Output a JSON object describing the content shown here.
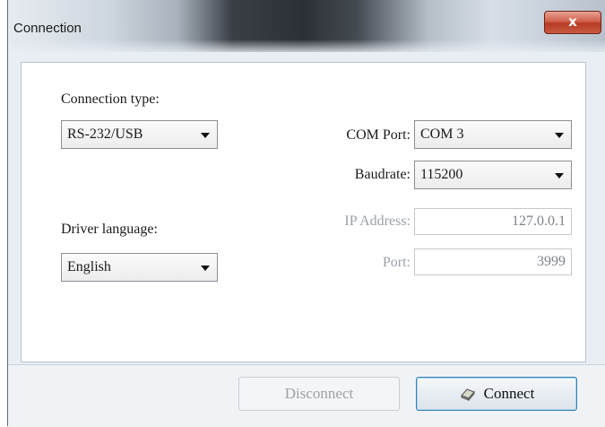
{
  "window": {
    "title": "Connection",
    "close_label": "x"
  },
  "connection_type": {
    "label": "Connection type:",
    "selected": "RS-232/USB"
  },
  "driver_language": {
    "label": "Driver language:",
    "selected": "English"
  },
  "com_port": {
    "label": "COM Port:",
    "selected": "COM 3"
  },
  "baudrate": {
    "label": "Baudrate:",
    "selected": "115200"
  },
  "ip_address": {
    "label": "IP Address:",
    "value": "127.0.0.1"
  },
  "port": {
    "label": "Port:",
    "value": "3999"
  },
  "buttons": {
    "disconnect": "Disconnect",
    "connect": "Connect",
    "connect_icon": "plug-icon"
  }
}
